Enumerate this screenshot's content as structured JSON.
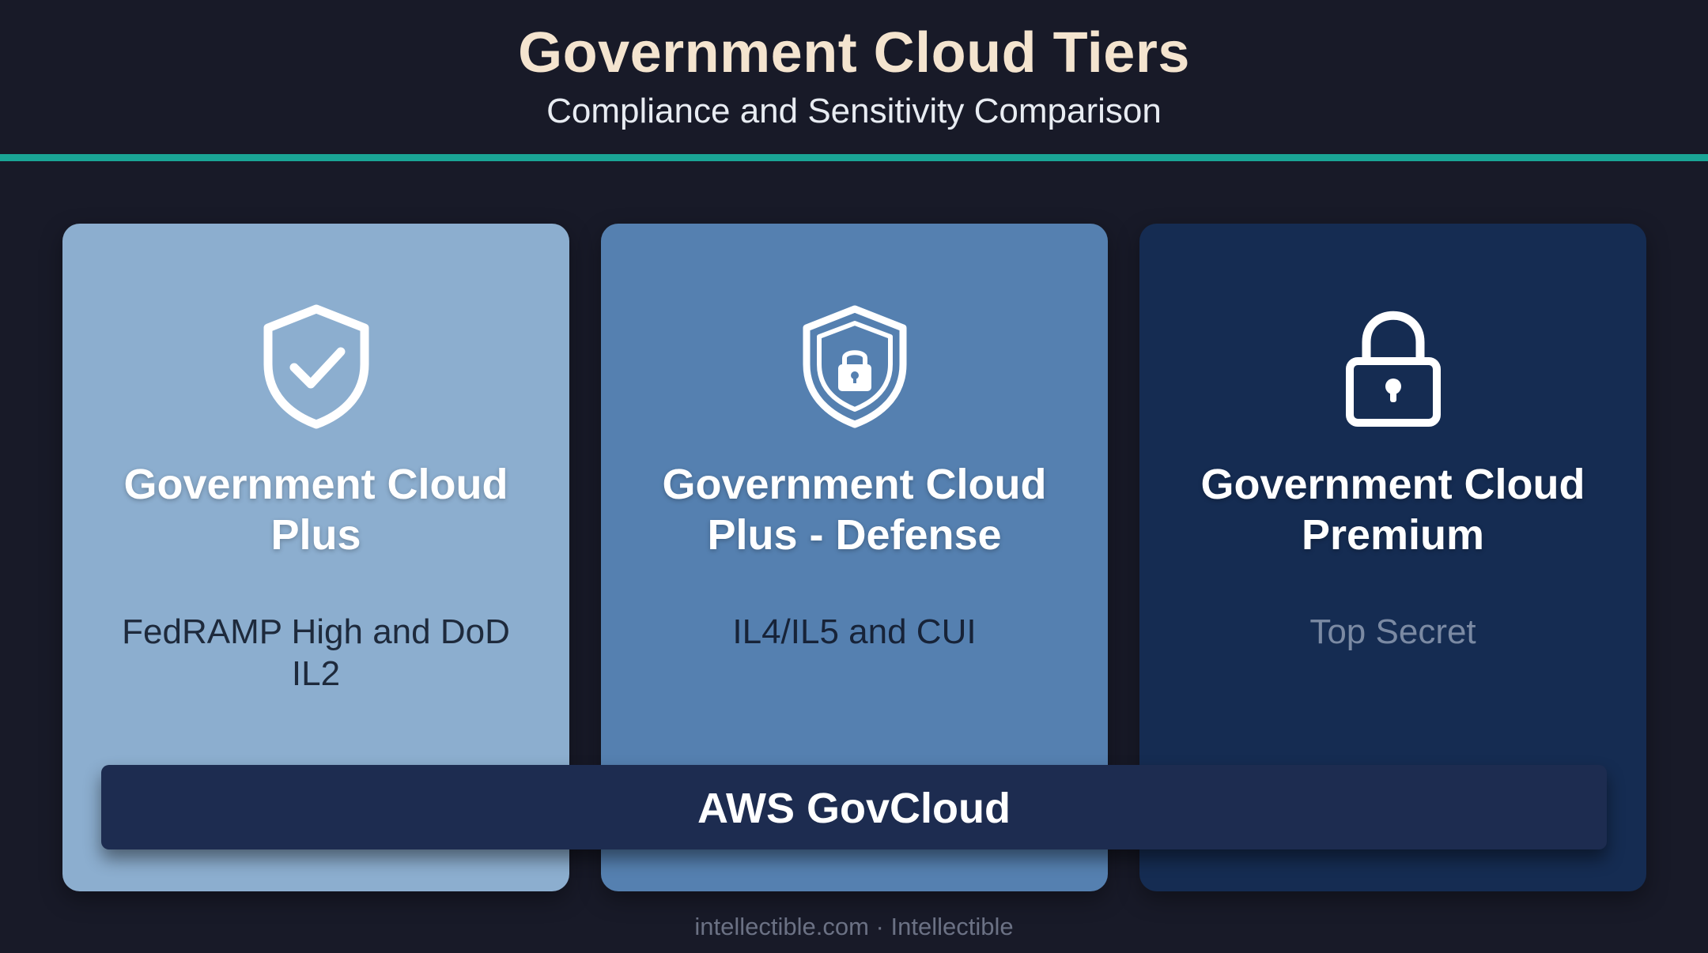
{
  "header": {
    "title": "Government Cloud Tiers",
    "subtitle": "Compliance and Sensitivity Comparison"
  },
  "colors": {
    "background": "#181a28",
    "accent_rule": "#1aa596",
    "title": "#f4e4cf",
    "tier_1": "#8caecf",
    "tier_2": "#5580b0",
    "tier_3": "#152c52",
    "banner": "#1d2c50"
  },
  "tiers": [
    {
      "icon": "shield-check-icon",
      "name": "Government Cloud Plus",
      "compliance": "FedRAMP High and DoD IL2"
    },
    {
      "icon": "shield-lock-icon",
      "name": "Government Cloud Plus - Defense",
      "compliance": "IL4/IL5 and CUI"
    },
    {
      "icon": "padlock-icon",
      "name": "Government Cloud Premium",
      "compliance": "Top Secret"
    }
  ],
  "banner": {
    "label": "AWS GovCloud"
  },
  "footer": {
    "credit": "intellectible.com · Intellectible"
  }
}
